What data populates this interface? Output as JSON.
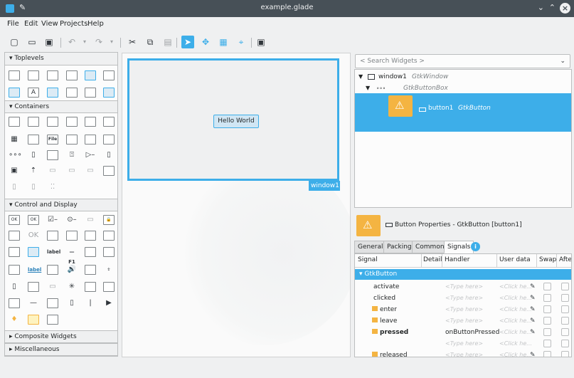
{
  "window": {
    "title": "example.glade"
  },
  "menu": [
    "File",
    "Edit",
    "View",
    "Projects",
    "Help"
  ],
  "toolbar_icons": [
    "new-icon",
    "open-icon",
    "save-icon",
    "undo-icon",
    "undo-menu-icon",
    "redo-icon",
    "redo-menu-icon",
    "cut-icon",
    "copy-icon",
    "paste-icon",
    "select-icon",
    "drag-resize-icon",
    "margin-edit-icon",
    "align-edit-icon",
    "preview-icon"
  ],
  "palette": {
    "sections": {
      "toplevels": "▾ Toplevels",
      "containers": "▾ Containers",
      "control": "▾ Control and Display",
      "composite": "▸ Composite Widgets",
      "misc": "▸ Miscellaneous"
    },
    "icon_texts": {
      "label_a": "A",
      "ok1": "OK",
      "ok2": "OK",
      "label_word": "label",
      "f1": "—F1",
      "label_link": "label",
      "file": "File"
    }
  },
  "canvas": {
    "button_label": "Hello World",
    "window_label": "window1"
  },
  "inspector": {
    "search_placeholder": "< Search Widgets >",
    "tree": {
      "window_name": "window1",
      "window_type": "GtkWindow",
      "box_type": "GtkButtonBox",
      "button_name": "button1",
      "button_type": "GtkButton"
    },
    "props_title": "Button Properties - GtkButton [button1]",
    "tabs": [
      "General",
      "Packing",
      "Common",
      "Signals"
    ],
    "signals": {
      "headers": [
        "Signal",
        "Detail",
        "Handler",
        "User data",
        "Swap",
        "Afte"
      ],
      "group": "GtkButton",
      "type_placeholder": "<Type here>",
      "click_placeholder": "<Click he...",
      "rows": [
        {
          "name": "activate",
          "handler": "",
          "flag": false,
          "bold": false
        },
        {
          "name": "clicked",
          "handler": "",
          "flag": false,
          "bold": false
        },
        {
          "name": "enter",
          "handler": "",
          "flag": true,
          "bold": false
        },
        {
          "name": "leave",
          "handler": "",
          "flag": true,
          "bold": false
        },
        {
          "name": "pressed",
          "handler": "onButtonPressed",
          "flag": true,
          "bold": true
        },
        {
          "name": "",
          "handler": "",
          "flag": false,
          "bold": false
        },
        {
          "name": "released",
          "handler": "",
          "flag": true,
          "bold": false
        }
      ]
    }
  }
}
